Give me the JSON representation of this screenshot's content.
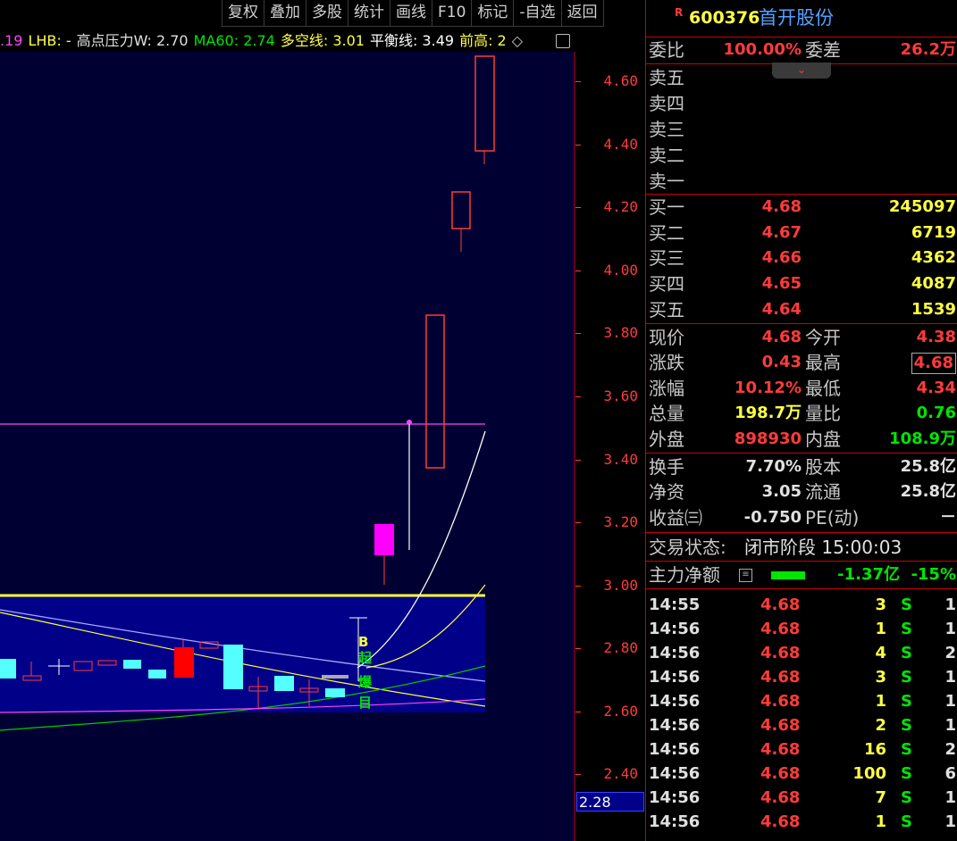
{
  "toolbar": {
    "buttons": [
      "复权",
      "叠加",
      "多股",
      "统计",
      "画线",
      "F10",
      "标记",
      "-自选",
      "返回"
    ]
  },
  "indicator_line": {
    "lead": ".19",
    "lhb": "LHB: -",
    "high_pressure": "高点压力W: 2.70",
    "ma60": "MA60: 2.74",
    "long_short": "多空线: 3.01",
    "balance": "平衡线: 3.49",
    "prev_high": "前高: 2"
  },
  "chart": {
    "labels": [
      "B",
      "起",
      "爆",
      "目"
    ],
    "colors": {
      "up": "#ff3b3b",
      "down": "#54ffff",
      "bg": "#000033",
      "box": "#000088"
    }
  },
  "axis": {
    "ticks": [
      "4.60",
      "4.40",
      "4.20",
      "4.00",
      "3.80",
      "3.60",
      "3.40",
      "3.20",
      "3.00",
      "2.80",
      "2.60",
      "2.40"
    ],
    "current": "2.28"
  },
  "stock": {
    "badge": "R",
    "code": "600376",
    "name": "首开股份"
  },
  "wei": {
    "wb_label": "委比",
    "wb_value": "100.00%",
    "wc_label": "委差",
    "wc_value": "26.2万"
  },
  "sell": [
    {
      "label": "卖五"
    },
    {
      "label": "卖四"
    },
    {
      "label": "卖三"
    },
    {
      "label": "卖二"
    },
    {
      "label": "卖一"
    }
  ],
  "buy": [
    {
      "label": "买一",
      "price": "4.68",
      "vol": "245097"
    },
    {
      "label": "买二",
      "price": "4.67",
      "vol": "6719"
    },
    {
      "label": "买三",
      "price": "4.66",
      "vol": "4362"
    },
    {
      "label": "买四",
      "price": "4.65",
      "vol": "4087"
    },
    {
      "label": "买五",
      "price": "4.64",
      "vol": "1539"
    }
  ],
  "quote": [
    {
      "l1": "现价",
      "v1": "4.68",
      "c1": "red",
      "l2": "今开",
      "v2": "4.38",
      "c2": "red"
    },
    {
      "l1": "涨跌",
      "v1": "0.43",
      "c1": "red",
      "l2": "最高",
      "v2": "4.68",
      "c2": "red"
    },
    {
      "l1": "涨幅",
      "v1": "10.12%",
      "c1": "red",
      "l2": "最低",
      "v2": "4.34",
      "c2": "red"
    },
    {
      "l1": "总量",
      "v1": "198.7万",
      "c1": "yellow",
      "l2": "量比",
      "v2": "0.76",
      "c2": "green"
    },
    {
      "l1": "外盘",
      "v1": "898930",
      "c1": "red",
      "l2": "内盘",
      "v2": "108.9万",
      "c2": "green"
    }
  ],
  "fund": [
    {
      "l1": "换手",
      "v1": "7.70%",
      "l2": "股本",
      "v2": "25.8亿"
    },
    {
      "l1": "净资",
      "v1": "3.05",
      "l2": "流通",
      "v2": "25.8亿"
    },
    {
      "l1": "收益㈢",
      "v1": "-0.750",
      "l2": "PE(动)",
      "v2": "－"
    }
  ],
  "status": {
    "label": "交易状态:",
    "value": "闭市阶段 15:00:03"
  },
  "main_net": {
    "label": "主力净额",
    "value": "-1.37亿",
    "pct": "-15%"
  },
  "trades": [
    {
      "time": "14:55",
      "price": "4.68",
      "vol": "3",
      "bs": "S",
      "n": "1"
    },
    {
      "time": "14:56",
      "price": "4.68",
      "vol": "1",
      "bs": "S",
      "n": "1"
    },
    {
      "time": "14:56",
      "price": "4.68",
      "vol": "4",
      "bs": "S",
      "n": "2"
    },
    {
      "time": "14:56",
      "price": "4.68",
      "vol": "3",
      "bs": "S",
      "n": "1"
    },
    {
      "time": "14:56",
      "price": "4.68",
      "vol": "1",
      "bs": "S",
      "n": "1"
    },
    {
      "time": "14:56",
      "price": "4.68",
      "vol": "2",
      "bs": "S",
      "n": "1"
    },
    {
      "time": "14:56",
      "price": "4.68",
      "vol": "16",
      "bs": "S",
      "n": "2"
    },
    {
      "time": "14:56",
      "price": "4.68",
      "vol": "100",
      "bs": "S",
      "n": "6"
    },
    {
      "time": "14:56",
      "price": "4.68",
      "vol": "7",
      "bs": "S",
      "n": "1"
    },
    {
      "time": "14:56",
      "price": "4.68",
      "vol": "1",
      "bs": "S",
      "n": "1"
    }
  ]
}
